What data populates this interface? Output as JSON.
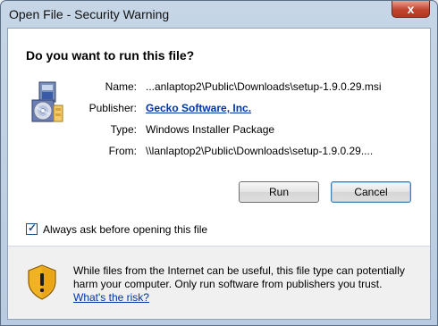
{
  "window": {
    "title": "Open File - Security Warning",
    "close_symbol": "x"
  },
  "question": "Do you want to run this file?",
  "details": [
    {
      "label": "Name:",
      "value": "...anlaptop2\\Public\\Downloads\\setup-1.9.0.29.msi"
    },
    {
      "label": "Publisher:",
      "value": "Gecko Software, Inc."
    },
    {
      "label": "Type:",
      "value": "Windows Installer Package"
    },
    {
      "label": "From:",
      "value": "\\\\lanlaptop2\\Public\\Downloads\\setup-1.9.0.29...."
    }
  ],
  "buttons": {
    "run": "Run",
    "cancel": "Cancel"
  },
  "checkbox": {
    "label": "Always ask before opening this file",
    "checked": true
  },
  "warning": {
    "text": "While files from the Internet can be useful, this file type can potentially harm your computer. Only run software from publishers you trust.",
    "link": "What's the risk?"
  },
  "icons": {
    "installer": "installer-package-icon",
    "shield": "security-shield-icon"
  }
}
